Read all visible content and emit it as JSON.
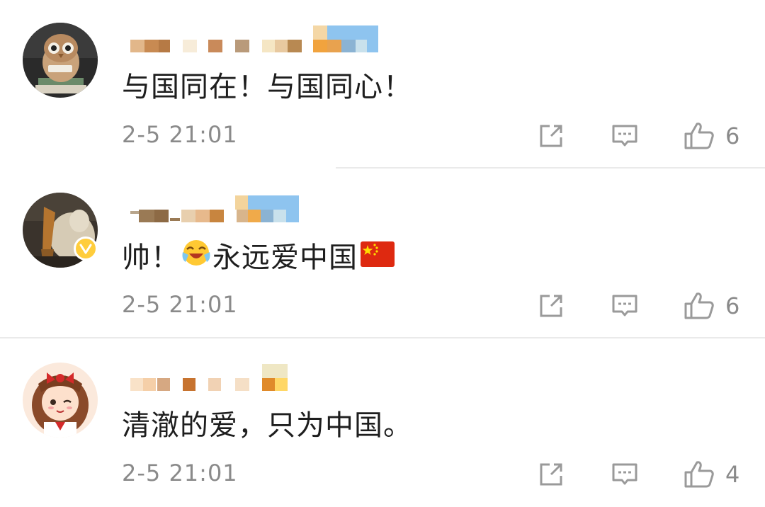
{
  "comments": [
    {
      "text": "与国同在！与国同心！",
      "emoji": null,
      "timestamp": "2-5 21:01",
      "like_count": "6",
      "verified": false,
      "avatar_icon": "owl-figurine-avatar"
    },
    {
      "text_before": "帅！",
      "emoji": "laughing-crying-emoji",
      "text_after": "永远爱中国",
      "flag": "china-flag-emoji",
      "timestamp": "2-5 21:01",
      "like_count": "6",
      "verified": true,
      "avatar_icon": "sculpture-avatar"
    },
    {
      "text": "清澈的爱，只为中国。",
      "emoji": null,
      "timestamp": "2-5 21:01",
      "like_count": "4",
      "verified": false,
      "avatar_icon": "anime-girl-avatar"
    }
  ],
  "actions": {
    "forward_icon": "share-forward-icon",
    "reply_icon": "comment-reply-icon",
    "like_icon": "thumbs-up-icon"
  },
  "colors": {
    "text_primary": "#1e1e1e",
    "text_secondary": "#8a8a8a",
    "divider": "#eaeaea",
    "verified_badge": "#ffcd3c",
    "icon_gray": "#9a9a9a"
  }
}
